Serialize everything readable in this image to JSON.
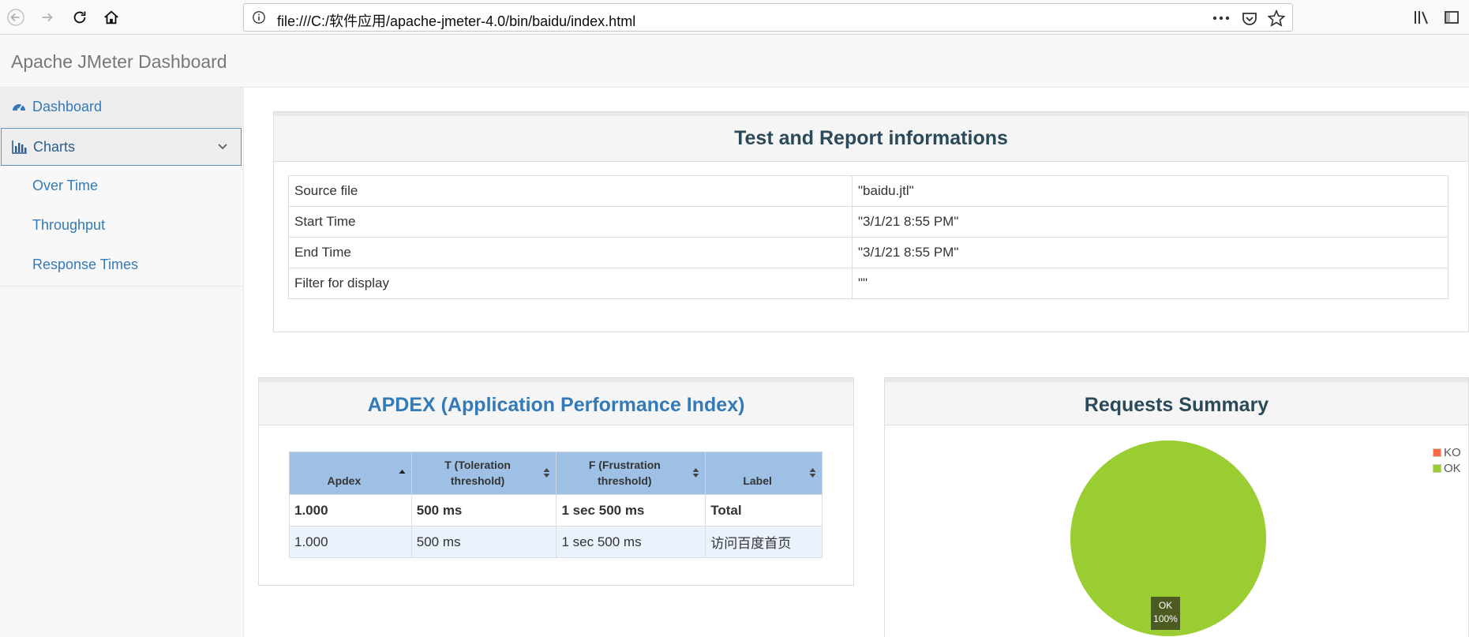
{
  "browser": {
    "url": "file:///C:/软件应用/apache-jmeter-4.0/bin/baidu/index.html"
  },
  "header": {
    "brand": "Apache JMeter Dashboard"
  },
  "sidebar": {
    "dashboard": "Dashboard",
    "charts": "Charts",
    "sub_items": [
      "Over Time",
      "Throughput",
      "Response Times"
    ]
  },
  "test_info": {
    "title": "Test and Report informations",
    "rows": [
      {
        "key": "Source file",
        "value": "\"baidu.jtl\""
      },
      {
        "key": "Start Time",
        "value": "\"3/1/21 8:55 PM\""
      },
      {
        "key": "End Time",
        "value": "\"3/1/21 8:55 PM\""
      },
      {
        "key": "Filter for display",
        "value": "\"\""
      }
    ]
  },
  "apdex": {
    "title": "APDEX (Application Performance Index)",
    "columns": [
      "Apdex",
      "T (Toleration threshold)",
      "F (Frustration threshold)",
      "Label"
    ],
    "rows": [
      [
        "1.000",
        "500 ms",
        "1 sec 500 ms",
        "Total"
      ],
      [
        "1.000",
        "500 ms",
        "1 sec 500 ms",
        "访问百度首页"
      ]
    ]
  },
  "requests_summary": {
    "title": "Requests Summary",
    "chart_data": {
      "type": "pie",
      "categories": [
        "KO",
        "OK"
      ],
      "values": [
        0,
        100
      ],
      "colors": [
        "#fd6a4a",
        "#9acd32"
      ],
      "slice_label": {
        "name": "OK",
        "percent": "100%"
      },
      "legend": "top-right"
    }
  },
  "colors": {
    "link": "#337ab7",
    "apdex_title": "#337ab7",
    "table_header": "#9fc0e5",
    "ok": "#9acd32",
    "ko": "#fd6a4a"
  }
}
